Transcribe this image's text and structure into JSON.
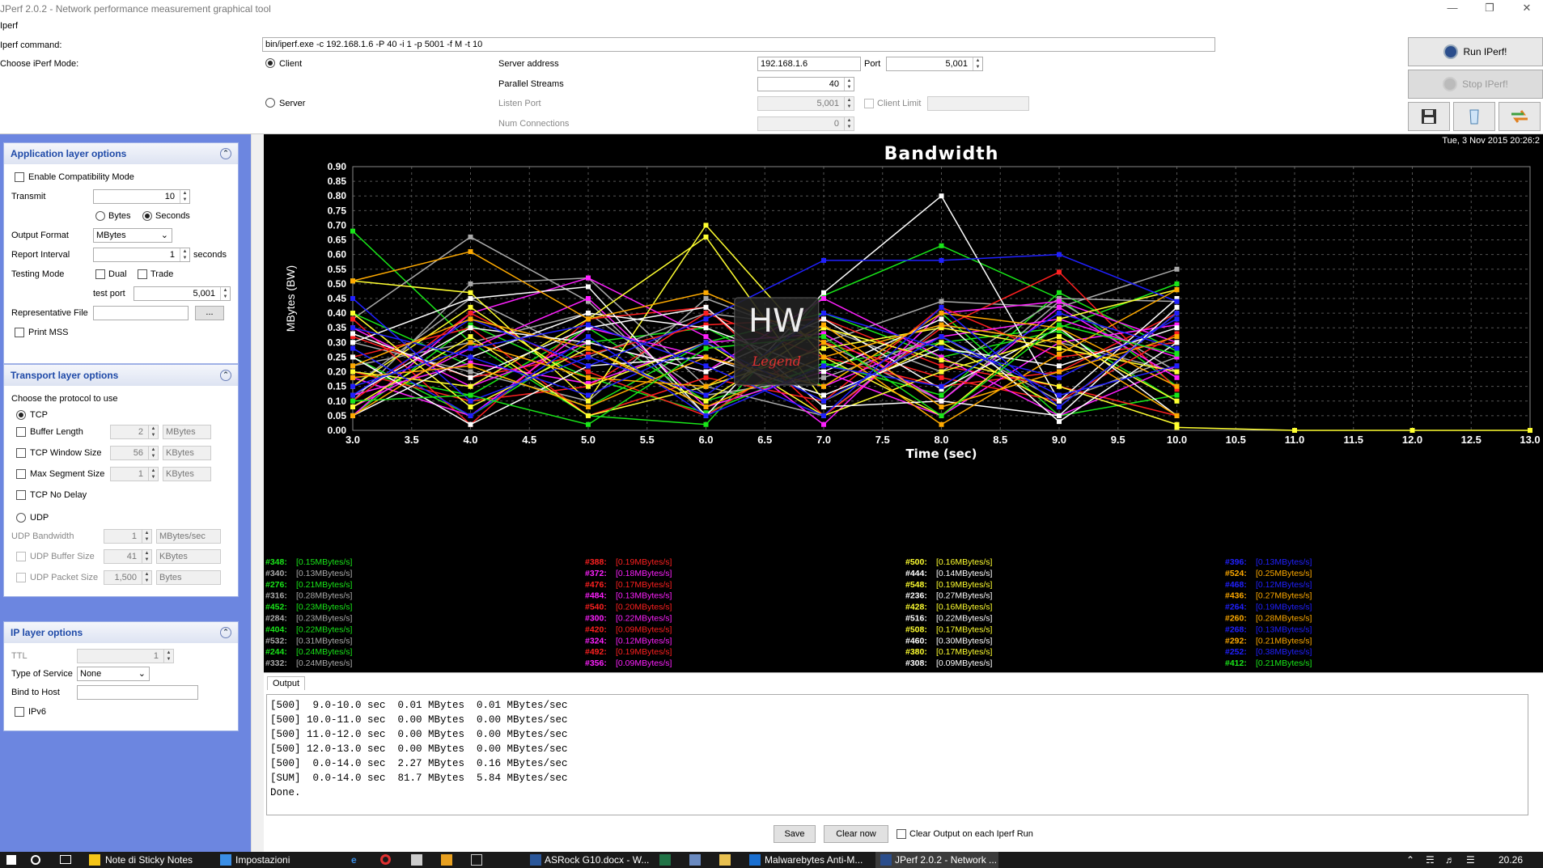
{
  "window": {
    "title": "JPerf 2.0.2 - Network performance measurement graphical tool"
  },
  "menu": {
    "label": "Iperf"
  },
  "form": {
    "iperf_command_label": "Iperf command:",
    "iperf_command_value": "bin/iperf.exe -c 192.168.1.6 -P 40 -i 1 -p 5001 -f M -t 10",
    "mode_label": "Choose iPerf Mode:",
    "client_label": "Client",
    "server_label": "Server",
    "server_address_label": "Server address",
    "server_address_value": "192.168.1.6",
    "port_label": "Port",
    "port_value": "5,001",
    "parallel_label": "Parallel Streams",
    "parallel_value": "40",
    "listen_port_label": "Listen Port",
    "listen_port_value": "5,001",
    "client_limit_label": "Client Limit",
    "num_conn_label": "Num Connections",
    "num_conn_value": "0"
  },
  "actions": {
    "run": "Run IPerf!",
    "stop": "Stop IPerf!"
  },
  "app_layer": {
    "title": "Application layer options",
    "compat": "Enable Compatibility Mode",
    "transmit_label": "Transmit",
    "transmit_value": "10",
    "bytes": "Bytes",
    "seconds": "Seconds",
    "output_format_label": "Output Format",
    "output_format_value": "MBytes",
    "report_interval_label": "Report Interval",
    "report_interval_value": "1",
    "report_interval_unit": "seconds",
    "testing_mode_label": "Testing Mode",
    "dual": "Dual",
    "trade": "Trade",
    "test_port_label": "test port",
    "test_port_value": "5,001",
    "rep_file_label": "Representative File",
    "browse": "...",
    "print_mss": "Print MSS"
  },
  "transport": {
    "title": "Transport layer options",
    "choose": "Choose the protocol to use",
    "tcp": "TCP",
    "buffer_length": "Buffer Length",
    "buffer_length_value": "2",
    "buffer_length_unit": "MBytes",
    "tcp_window": "TCP Window Size",
    "tcp_window_value": "56",
    "tcp_window_unit": "KBytes",
    "max_seg": "Max Segment Size",
    "max_seg_value": "1",
    "max_seg_unit": "KBytes",
    "no_delay": "TCP No Delay",
    "udp": "UDP",
    "udp_bw": "UDP Bandwidth",
    "udp_bw_value": "1",
    "udp_bw_unit": "MBytes/sec",
    "udp_buf": "UDP Buffer Size",
    "udp_buf_value": "41",
    "udp_buf_unit": "KBytes",
    "udp_pkt": "UDP Packet Size",
    "udp_pkt_value": "1,500",
    "udp_pkt_unit": "Bytes"
  },
  "ip_layer": {
    "title": "IP layer options",
    "ttl": "TTL",
    "ttl_value": "1",
    "tos": "Type of Service",
    "tos_value": "None",
    "bind": "Bind to Host",
    "ipv6": "IPv6"
  },
  "chart_date": "Tue, 3 Nov 2015 20:26:2",
  "chart_data": {
    "type": "line",
    "title": "Bandwidth",
    "xlabel": "Time (sec)",
    "ylabel": "MBytes (BW)",
    "xlim": [
      3.0,
      13.0
    ],
    "ylim": [
      0.0,
      0.9
    ],
    "xticks": [
      "3.0",
      "3.5",
      "4.0",
      "4.5",
      "5.0",
      "5.5",
      "6.0",
      "6.5",
      "7.0",
      "7.5",
      "8.0",
      "8.5",
      "9.0",
      "9.5",
      "10.0",
      "10.5",
      "11.0",
      "11.5",
      "12.0",
      "12.5",
      "13.0"
    ],
    "yticks": [
      "0.00",
      "0.05",
      "0.10",
      "0.15",
      "0.20",
      "0.25",
      "0.30",
      "0.35",
      "0.40",
      "0.45",
      "0.50",
      "0.55",
      "0.60",
      "0.65",
      "0.70",
      "0.75",
      "0.80",
      "0.85",
      "0.90"
    ],
    "grid": true,
    "x": [
      3,
      4,
      5,
      6,
      7,
      8,
      9,
      10
    ],
    "series": [
      {
        "name": "#348",
        "color": "#19e619",
        "values": [
          0.68,
          0.3,
          0.05,
          0.02,
          0.46,
          0.63,
          0.45,
          0.15
        ]
      },
      {
        "name": "#340",
        "color": "#aaaaaa",
        "values": [
          0.38,
          0.66,
          0.44,
          0.05,
          0.3,
          0.44,
          0.42,
          0.55
        ]
      },
      {
        "name": "#276",
        "color": "#19e619",
        "values": [
          0.2,
          0.12,
          0.35,
          0.1,
          0.22,
          0.3,
          0.35,
          0.5
        ]
      },
      {
        "name": "#316",
        "color": "#aaaaaa",
        "values": [
          0.1,
          0.5,
          0.52,
          0.15,
          0.05,
          0.36,
          0.3,
          0.2
        ]
      },
      {
        "name": "#452",
        "color": "#19e619",
        "values": [
          0.25,
          0.05,
          0.3,
          0.35,
          0.15,
          0.4,
          0.05,
          0.12
        ]
      },
      {
        "name": "#284",
        "color": "#aaaaaa",
        "values": [
          0.3,
          0.2,
          0.1,
          0.45,
          0.3,
          0.1,
          0.44,
          0.2
        ]
      },
      {
        "name": "#404",
        "color": "#19e619",
        "values": [
          0.05,
          0.36,
          0.18,
          0.06,
          0.23,
          0.12,
          0.47,
          0.27
        ]
      },
      {
        "name": "#532",
        "color": "#aaaaaa",
        "values": [
          0.15,
          0.45,
          0.25,
          0.4,
          0.35,
          0.2,
          0.45,
          0.44
        ]
      },
      {
        "name": "#244",
        "color": "#19e619",
        "values": [
          0.4,
          0.22,
          0.08,
          0.3,
          0.4,
          0.25,
          0.34,
          0.1
        ]
      },
      {
        "name": "#332",
        "color": "#aaaaaa",
        "values": [
          0.22,
          0.3,
          0.4,
          0.12,
          0.18,
          0.32,
          0.1,
          0.25
        ]
      },
      {
        "name": "#388",
        "color": "#ff2020",
        "values": [
          0.38,
          0.02,
          0.38,
          0.42,
          0.05,
          0.35,
          0.54,
          0.14
        ]
      },
      {
        "name": "#372",
        "color": "#ff20ff",
        "values": [
          0.05,
          0.4,
          0.52,
          0.32,
          0.02,
          0.4,
          0.44,
          0.3
        ]
      },
      {
        "name": "#476",
        "color": "#ff2020",
        "values": [
          0.2,
          0.1,
          0.15,
          0.4,
          0.25,
          0.15,
          0.2,
          0.4
        ]
      },
      {
        "name": "#484",
        "color": "#ff20ff",
        "values": [
          0.12,
          0.23,
          0.16,
          0.3,
          0.33,
          0.1,
          0.42,
          0.18
        ]
      },
      {
        "name": "#540",
        "color": "#ff2020",
        "values": [
          0.25,
          0.35,
          0.05,
          0.18,
          0.1,
          0.42,
          0.25,
          0.3
        ]
      },
      {
        "name": "#300",
        "color": "#ff20ff",
        "values": [
          0.08,
          0.28,
          0.45,
          0.08,
          0.2,
          0.05,
          0.3,
          0.36
        ]
      },
      {
        "name": "#420",
        "color": "#ff2020",
        "values": [
          0.32,
          0.18,
          0.26,
          0.36,
          0.38,
          0.22,
          0.15,
          0.05
        ]
      },
      {
        "name": "#324",
        "color": "#ff20ff",
        "values": [
          0.18,
          0.05,
          0.35,
          0.25,
          0.15,
          0.32,
          0.38,
          0.25
        ]
      },
      {
        "name": "#492",
        "color": "#ff2020",
        "values": [
          0.1,
          0.4,
          0.2,
          0.05,
          0.3,
          0.18,
          0.1,
          0.33
        ]
      },
      {
        "name": "#356",
        "color": "#ff20ff",
        "values": [
          0.35,
          0.15,
          0.3,
          0.2,
          0.45,
          0.25,
          0.05,
          0.22
        ]
      },
      {
        "name": "#500",
        "color": "#ffff30",
        "values": [
          0.51,
          0.47,
          0.1,
          0.7,
          0.25,
          0.05,
          0.38,
          0.48
        ]
      },
      {
        "name": "#444",
        "color": "#ffffff",
        "values": [
          0.3,
          0.45,
          0.49,
          0.05,
          0.47,
          0.8,
          0.1,
          0.45
        ]
      },
      {
        "name": "#548",
        "color": "#ffff30",
        "values": [
          0.2,
          0.15,
          0.38,
          0.66,
          0.1,
          0.3,
          0.08,
          0.4
        ]
      },
      {
        "name": "#236",
        "color": "#ffffff",
        "values": [
          0.12,
          0.35,
          0.3,
          0.2,
          0.38,
          0.14,
          0.35,
          0.05
        ]
      },
      {
        "name": "#428",
        "color": "#ffff30",
        "values": [
          0.4,
          0.08,
          0.28,
          0.1,
          0.35,
          0.24,
          0.15,
          0.02
        ]
      },
      {
        "name": "#516",
        "color": "#ffffff",
        "values": [
          0.05,
          0.25,
          0.4,
          0.35,
          0.2,
          0.38,
          0.03,
          0.3
        ]
      },
      {
        "name": "#508",
        "color": "#ffff30",
        "values": [
          0.15,
          0.42,
          0.15,
          0.3,
          0.05,
          0.2,
          0.32,
          0.1
        ]
      },
      {
        "name": "#460",
        "color": "#ffffff",
        "values": [
          0.25,
          0.02,
          0.22,
          0.25,
          0.12,
          0.28,
          0.22,
          0.35
        ]
      },
      {
        "name": "#380",
        "color": "#ffff30",
        "values": [
          0.08,
          0.32,
          0.05,
          0.15,
          0.28,
          0.35,
          0.28,
          0.2
        ]
      },
      {
        "name": "#308",
        "color": "#ffffff",
        "values": [
          0.33,
          0.18,
          0.35,
          0.42,
          0.08,
          0.1,
          0.05,
          0.42
        ]
      },
      {
        "name": "#396",
        "color": "#2020ff",
        "values": [
          0.12,
          0.38,
          0.22,
          0.38,
          0.58,
          0.58,
          0.6,
          0.44
        ]
      },
      {
        "name": "#524",
        "color": "#ffaa00",
        "values": [
          0.51,
          0.61,
          0.38,
          0.47,
          0.3,
          0.02,
          0.26,
          0.48
        ]
      },
      {
        "name": "#468",
        "color": "#2020ff",
        "values": [
          0.45,
          0.1,
          0.25,
          0.12,
          0.4,
          0.28,
          0.18,
          0.38
        ]
      },
      {
        "name": "#436",
        "color": "#ffaa00",
        "values": [
          0.18,
          0.22,
          0.08,
          0.25,
          0.15,
          0.4,
          0.35,
          0.15
        ]
      },
      {
        "name": "#264",
        "color": "#2020ff",
        "values": [
          0.28,
          0.05,
          0.32,
          0.05,
          0.22,
          0.15,
          0.4,
          0.28
        ]
      },
      {
        "name": "#260",
        "color": "#ffaa00",
        "values": [
          0.05,
          0.3,
          0.18,
          0.15,
          0.36,
          0.08,
          0.2,
          0.32
        ]
      },
      {
        "name": "#268",
        "color": "#2020ff",
        "values": [
          0.35,
          0.25,
          0.12,
          0.3,
          0.1,
          0.32,
          0.12,
          0.22
        ]
      },
      {
        "name": "#292",
        "color": "#ffaa00",
        "values": [
          0.22,
          0.38,
          0.28,
          0.08,
          0.25,
          0.36,
          0.3,
          0.05
        ]
      },
      {
        "name": "#252",
        "color": "#2020ff",
        "values": [
          0.15,
          0.28,
          0.36,
          0.22,
          0.05,
          0.42,
          0.08,
          0.4
        ]
      },
      {
        "name": "#412",
        "color": "#19e619",
        "values": [
          0.1,
          0.12,
          0.02,
          0.28,
          0.32,
          0.05,
          0.36,
          0.26
        ]
      }
    ],
    "tail_x": [
      10,
      11,
      12,
      13
    ],
    "tail_values": [
      0.01,
      0.0,
      0.0,
      0.0
    ]
  },
  "legend": [
    [
      {
        "id": "#348:",
        "val": "[0.15MBytes/s]",
        "color": "#19e619"
      },
      {
        "id": "#340:",
        "val": "[0.13MBytes/s]",
        "color": "#aaaaaa"
      },
      {
        "id": "#276:",
        "val": "[0.21MBytes/s]",
        "color": "#19e619"
      },
      {
        "id": "#316:",
        "val": "[0.28MBytes/s]",
        "color": "#aaaaaa"
      },
      {
        "id": "#452:",
        "val": "[0.23MBytes/s]",
        "color": "#19e619"
      },
      {
        "id": "#284:",
        "val": "[0.23MBytes/s]",
        "color": "#aaaaaa"
      },
      {
        "id": "#404:",
        "val": "[0.22MBytes/s]",
        "color": "#19e619"
      },
      {
        "id": "#532:",
        "val": "[0.31MBytes/s]",
        "color": "#aaaaaa"
      },
      {
        "id": "#244:",
        "val": "[0.24MBytes/s]",
        "color": "#19e619"
      },
      {
        "id": "#332:",
        "val": "[0.24MBytes/s]",
        "color": "#aaaaaa"
      }
    ],
    [
      {
        "id": "#388:",
        "val": "[0.19MBytes/s]",
        "color": "#ff2020"
      },
      {
        "id": "#372:",
        "val": "[0.18MBytes/s]",
        "color": "#ff20ff"
      },
      {
        "id": "#476:",
        "val": "[0.17MBytes/s]",
        "color": "#ff2020"
      },
      {
        "id": "#484:",
        "val": "[0.13MBytes/s]",
        "color": "#ff20ff"
      },
      {
        "id": "#540:",
        "val": "[0.20MBytes/s]",
        "color": "#ff2020"
      },
      {
        "id": "#300:",
        "val": "[0.22MBytes/s]",
        "color": "#ff20ff"
      },
      {
        "id": "#420:",
        "val": "[0.09MBytes/s]",
        "color": "#ff2020"
      },
      {
        "id": "#324:",
        "val": "[0.12MBytes/s]",
        "color": "#ff20ff"
      },
      {
        "id": "#492:",
        "val": "[0.19MBytes/s]",
        "color": "#ff2020"
      },
      {
        "id": "#356:",
        "val": "[0.09MBytes/s]",
        "color": "#ff20ff"
      }
    ],
    [
      {
        "id": "#500:",
        "val": "[0.16MBytes/s]",
        "color": "#ffff30"
      },
      {
        "id": "#444:",
        "val": "[0.14MBytes/s]",
        "color": "#ffffff"
      },
      {
        "id": "#548:",
        "val": "[0.19MBytes/s]",
        "color": "#ffff30"
      },
      {
        "id": "#236:",
        "val": "[0.27MBytes/s]",
        "color": "#ffffff"
      },
      {
        "id": "#428:",
        "val": "[0.16MBytes/s]",
        "color": "#ffff30"
      },
      {
        "id": "#516:",
        "val": "[0.22MBytes/s]",
        "color": "#ffffff"
      },
      {
        "id": "#508:",
        "val": "[0.17MBytes/s]",
        "color": "#ffff30"
      },
      {
        "id": "#460:",
        "val": "[0.30MBytes/s]",
        "color": "#ffffff"
      },
      {
        "id": "#380:",
        "val": "[0.17MBytes/s]",
        "color": "#ffff30"
      },
      {
        "id": "#308:",
        "val": "[0.09MBytes/s]",
        "color": "#ffffff"
      }
    ],
    [
      {
        "id": "#396:",
        "val": "[0.13MBytes/s]",
        "color": "#2020ff"
      },
      {
        "id": "#524:",
        "val": "[0.25MBytes/s]",
        "color": "#ffaa00"
      },
      {
        "id": "#468:",
        "val": "[0.12MBytes/s]",
        "color": "#2020ff"
      },
      {
        "id": "#436:",
        "val": "[0.27MBytes/s]",
        "color": "#ffaa00"
      },
      {
        "id": "#264:",
        "val": "[0.19MBytes/s]",
        "color": "#2020ff"
      },
      {
        "id": "#260:",
        "val": "[0.28MBytes/s]",
        "color": "#ffaa00"
      },
      {
        "id": "#268:",
        "val": "[0.13MBytes/s]",
        "color": "#2020ff"
      },
      {
        "id": "#292:",
        "val": "[0.21MBytes/s]",
        "color": "#ffaa00"
      },
      {
        "id": "#252:",
        "val": "[0.38MBytes/s]",
        "color": "#2020ff"
      },
      {
        "id": "#412:",
        "val": "[0.21MBytes/s]",
        "color": "#19e619"
      }
    ]
  ],
  "output": {
    "tab": "Output",
    "text": "[500]  9.0-10.0 sec  0.01 MBytes  0.01 MBytes/sec\n[500] 10.0-11.0 sec  0.00 MBytes  0.00 MBytes/sec\n[500] 11.0-12.0 sec  0.00 MBytes  0.00 MBytes/sec\n[500] 12.0-13.0 sec  0.00 MBytes  0.00 MBytes/sec\n[500]  0.0-14.0 sec  2.27 MBytes  0.16 MBytes/sec\n[SUM]  0.0-14.0 sec  81.7 MBytes  5.84 MBytes/sec\nDone.",
    "save": "Save",
    "clear": "Clear now",
    "clear_each": "Clear Output on each Iperf Run"
  },
  "taskbar": {
    "items": [
      "Note di Sticky Notes",
      "Impostazioni",
      "ASRock G10.docx - W...",
      "Malwarebytes Anti-M...",
      "JPerf 2.0.2 - Network ..."
    ],
    "clock": "20.26"
  },
  "watermark": "Legend"
}
